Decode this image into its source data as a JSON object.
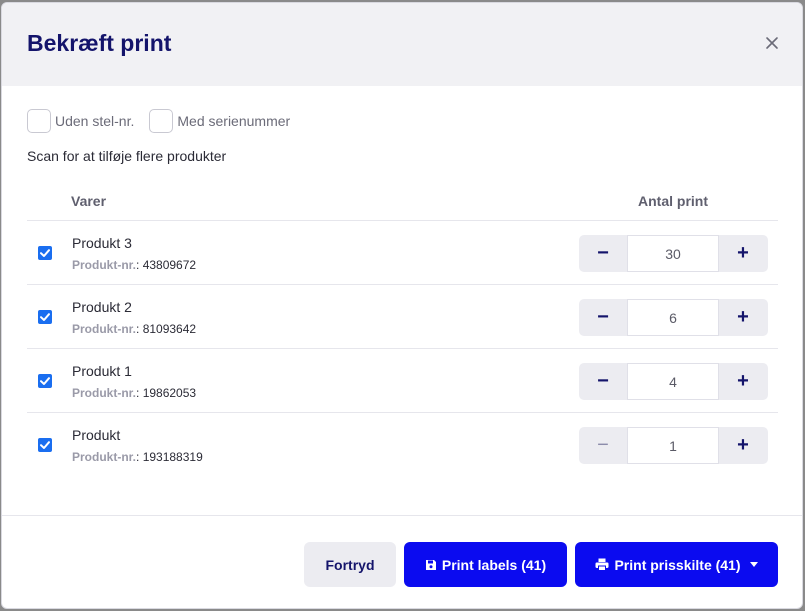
{
  "dialog": {
    "title": "Bekræft print"
  },
  "options": [
    {
      "label": "Uden stel-nr."
    },
    {
      "label": "Med serienummer"
    }
  ],
  "scan_hint": "Scan for at tilføje flere produkter",
  "table": {
    "columns": {
      "items": "Varer",
      "count": "Antal print"
    },
    "sku_label": "Produkt-nr.",
    "rows": [
      {
        "name": "Produkt 3",
        "sku": "43809672",
        "quantity": "30",
        "checked": true
      },
      {
        "name": "Produkt 2",
        "sku": "81093642",
        "quantity": "6",
        "checked": true
      },
      {
        "name": "Produkt 1",
        "sku": "19862053",
        "quantity": "4",
        "checked": true
      },
      {
        "name": "Produkt",
        "sku": "193188319",
        "quantity": "1",
        "checked": true
      }
    ]
  },
  "footer": {
    "cancel_label": "Fortryd",
    "print_labels_label": "Print labels (41)",
    "print_prices_label": "Print prisskilte (41)"
  },
  "icons": {
    "close": "close-icon",
    "decrement": "minus-icon",
    "increment": "plus-icon",
    "save": "floppy-disk-icon",
    "printer": "printer-icon",
    "caret": "caret-down-icon"
  },
  "colors": {
    "primary": "#0b0bf0",
    "title": "#14146b",
    "checkbox": "#1a6ef0",
    "header_bg": "#f1f1f4"
  }
}
